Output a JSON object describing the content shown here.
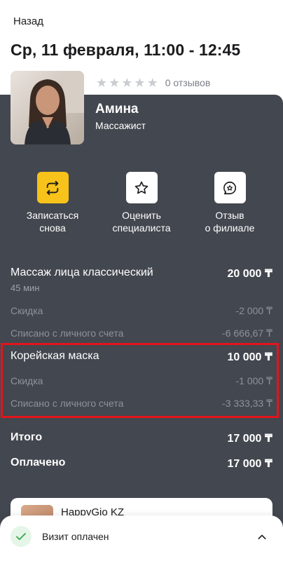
{
  "header": {
    "back_label": "Назад",
    "title": "Ср, 11 февраля, 11:00 - 12:45"
  },
  "specialist": {
    "name": "Амина",
    "role": "Массажист",
    "rating_stars": 0,
    "reviews_text": "0 отзывов"
  },
  "actions": [
    {
      "label": "Записаться\nснова",
      "icon": "repeat-icon"
    },
    {
      "label": "Оценить\nспециалиста",
      "icon": "star-outline-icon"
    },
    {
      "label": "Отзыв\nо филиале",
      "icon": "review-bubble-icon"
    }
  ],
  "services": [
    {
      "name": "Массаж лица классический",
      "price": "20 000 ₸",
      "duration": "45 мин",
      "discount_label": "Скидка",
      "discount_value": "-2 000 ₸",
      "account_label": "Списано с личного счета",
      "account_value": "-6 666,67 ₸"
    },
    {
      "name": "Корейская маска",
      "price": "10 000 ₸",
      "discount_label": "Скидка",
      "discount_value": "-1 000 ₸",
      "account_label": "Списано с личного счета",
      "account_value": "-3 333,33 ₸"
    }
  ],
  "totals": {
    "total_label": "Итого",
    "total_value": "17 000 ₸",
    "paid_label": "Оплачено",
    "paid_value": "17 000 ₸"
  },
  "store": {
    "name": "HappyGio KZ"
  },
  "status": {
    "text": "Визит оплачен"
  },
  "colors": {
    "accent_yellow": "#f7c31b",
    "card_bg": "#43474f",
    "highlight_red": "#e3141b",
    "success_green": "#3aa84d"
  }
}
